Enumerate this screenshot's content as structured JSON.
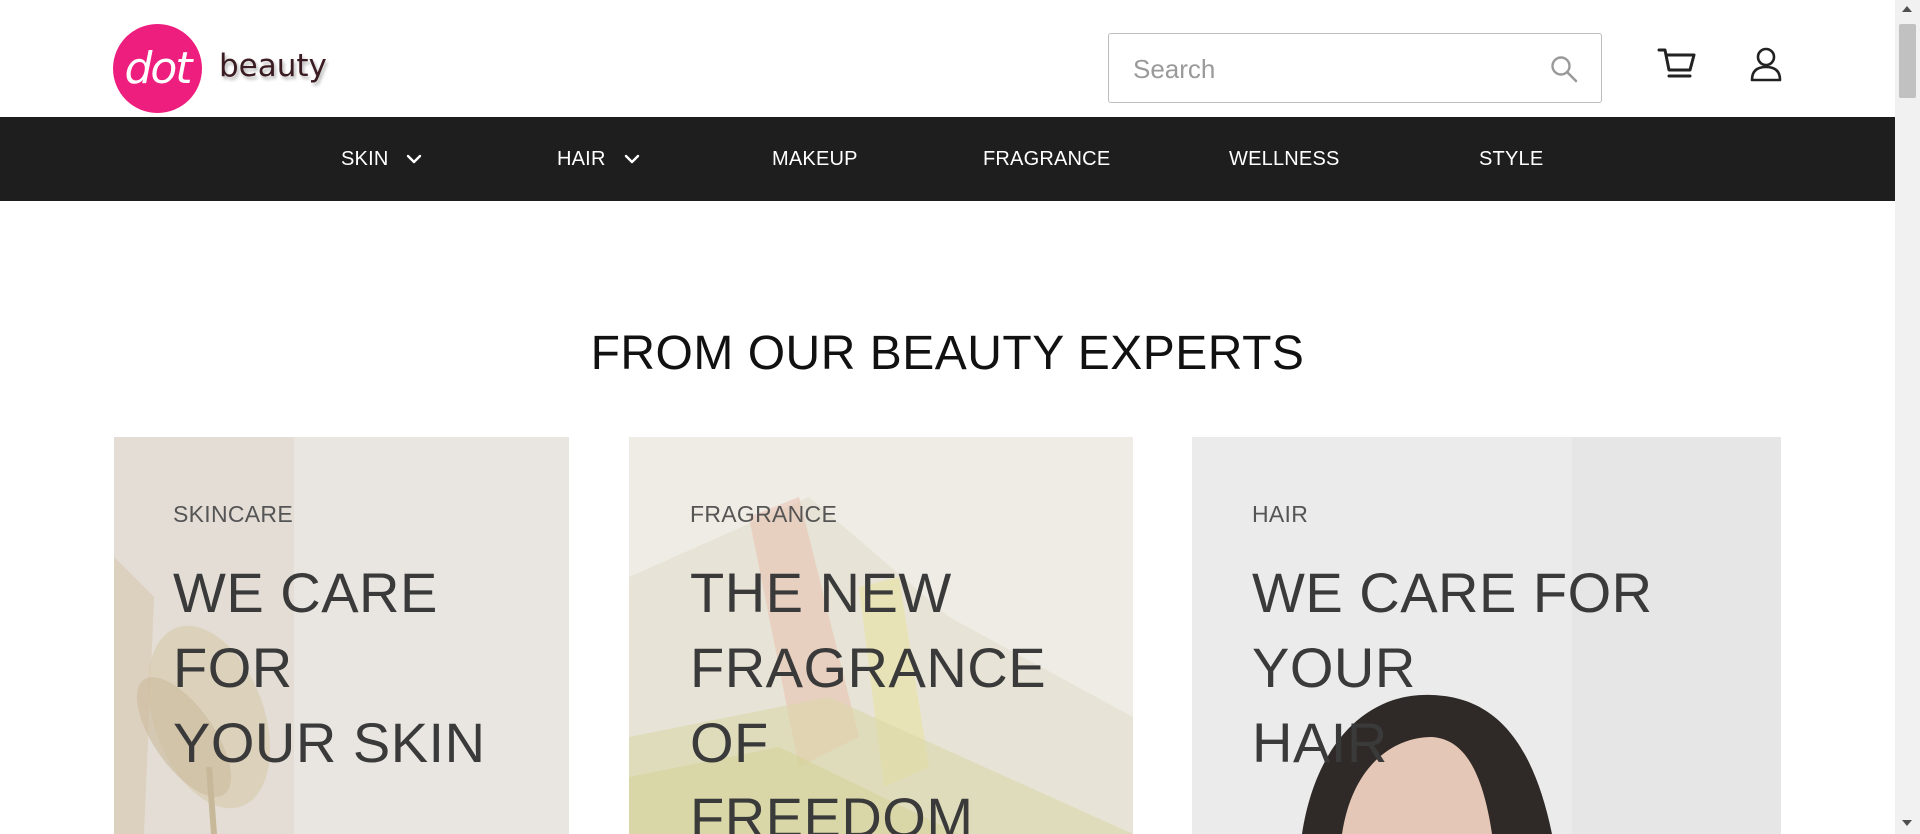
{
  "brand": {
    "logo_mark": "dot",
    "logo_word": "beauty",
    "accent": "#ee1e7e"
  },
  "search": {
    "placeholder": "Search",
    "value": ""
  },
  "header_icons": {
    "search": "search-icon",
    "cart": "cart-icon",
    "account": "user-icon"
  },
  "nav": {
    "items": [
      {
        "label": "SKIN",
        "has_dropdown": true
      },
      {
        "label": "HAIR",
        "has_dropdown": true
      },
      {
        "label": "MAKEUP",
        "has_dropdown": false
      },
      {
        "label": "FRAGRANCE",
        "has_dropdown": false
      },
      {
        "label": "WELLNESS",
        "has_dropdown": false
      },
      {
        "label": "STYLE",
        "has_dropdown": false
      }
    ],
    "background": "#1e1e1e"
  },
  "section": {
    "title": "FROM OUR BEAUTY EXPERTS"
  },
  "cards": [
    {
      "category": "SKINCARE",
      "title_lines": [
        "WE CARE FOR",
        "YOUR SKIN"
      ]
    },
    {
      "category": "FRAGRANCE",
      "title_lines": [
        "THE NEW",
        "FRAGRANCE OF",
        "FREEDOM"
      ]
    },
    {
      "category": "HAIR",
      "title_lines": [
        "WE CARE FOR YOUR",
        "HAIR"
      ]
    }
  ]
}
